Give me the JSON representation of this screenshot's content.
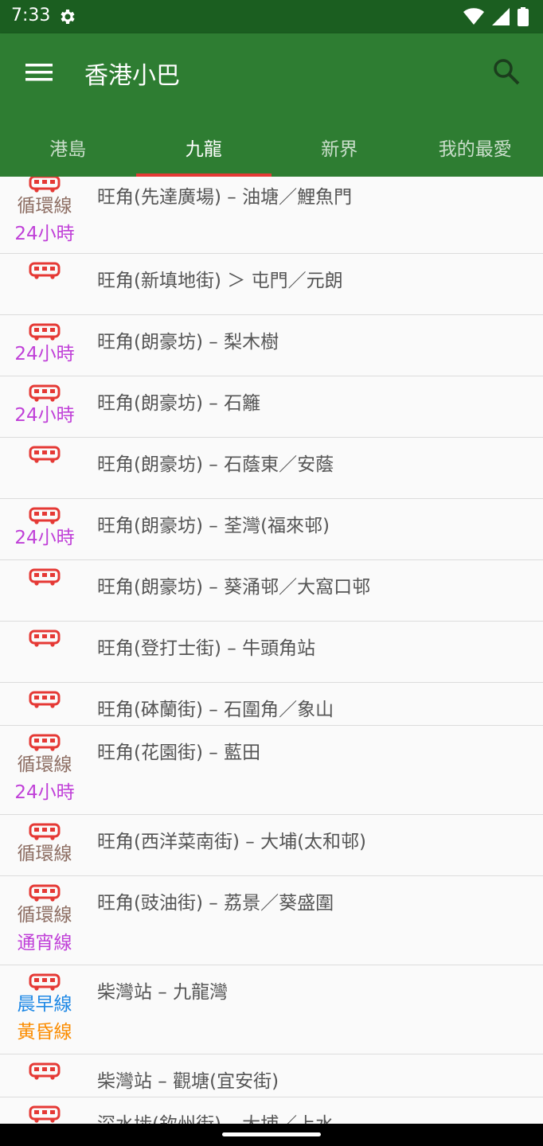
{
  "status_bar": {
    "time": "7:33"
  },
  "app_bar": {
    "title": "香港小巴"
  },
  "tabs": [
    {
      "label": "港島",
      "active": false
    },
    {
      "label": "九龍",
      "active": true
    },
    {
      "label": "新界",
      "active": false
    },
    {
      "label": "我的最愛",
      "active": false
    }
  ],
  "colors": {
    "primary": "#2e7d32",
    "primary_dark": "#1b5e20",
    "indicator": "#e53935",
    "bus_icon": "#e53935",
    "circular": "#8d6e63",
    "h24": "#c040d8",
    "overnight": "#c040d8",
    "morning": "#1e88e5",
    "evening": "#fb8c00"
  },
  "routes": [
    {
      "name": "旺角(先達廣場) – 油塘／鯉魚門",
      "tags": [
        {
          "text": "循環線",
          "type": "circular"
        },
        {
          "text": "24小時",
          "type": "h24"
        }
      ]
    },
    {
      "name": "旺角(新填地街) ＞ 屯門／元朗",
      "tags": []
    },
    {
      "name": "旺角(朗豪坊) – 梨木樹",
      "tags": [
        {
          "text": "24小時",
          "type": "h24"
        }
      ]
    },
    {
      "name": "旺角(朗豪坊) – 石籬",
      "tags": [
        {
          "text": "24小時",
          "type": "h24"
        }
      ]
    },
    {
      "name": "旺角(朗豪坊) – 石蔭東／安蔭",
      "tags": []
    },
    {
      "name": "旺角(朗豪坊) – 荃灣(福來邨)",
      "tags": [
        {
          "text": "24小時",
          "type": "h24"
        }
      ]
    },
    {
      "name": "旺角(朗豪坊) – 葵涌邨／大窩口邨",
      "tags": []
    },
    {
      "name": "旺角(登打士街) – 牛頭角站",
      "tags": []
    },
    {
      "name": "旺角(砵蘭街) – 石圍角／象山",
      "tags": []
    },
    {
      "name": "旺角(花園街) – 藍田",
      "tags": [
        {
          "text": "循環線",
          "type": "circular"
        },
        {
          "text": "24小時",
          "type": "h24"
        }
      ]
    },
    {
      "name": "旺角(西洋菜南街) – 大埔(太和邨)",
      "tags": [
        {
          "text": "循環線",
          "type": "circular"
        }
      ]
    },
    {
      "name": "旺角(豉油街) – 荔景／葵盛圍",
      "tags": [
        {
          "text": "循環線",
          "type": "circular"
        },
        {
          "text": "通宵線",
          "type": "overnight"
        }
      ]
    },
    {
      "name": "柴灣站 – 九龍灣",
      "tags": [
        {
          "text": "晨早線",
          "type": "morning"
        },
        {
          "text": "黃昏線",
          "type": "evening"
        }
      ]
    },
    {
      "name": "柴灣站 – 觀塘(宜安街)",
      "tags": []
    },
    {
      "name": "深水埗(欽州街) – 大埔／上水",
      "tags": []
    }
  ]
}
